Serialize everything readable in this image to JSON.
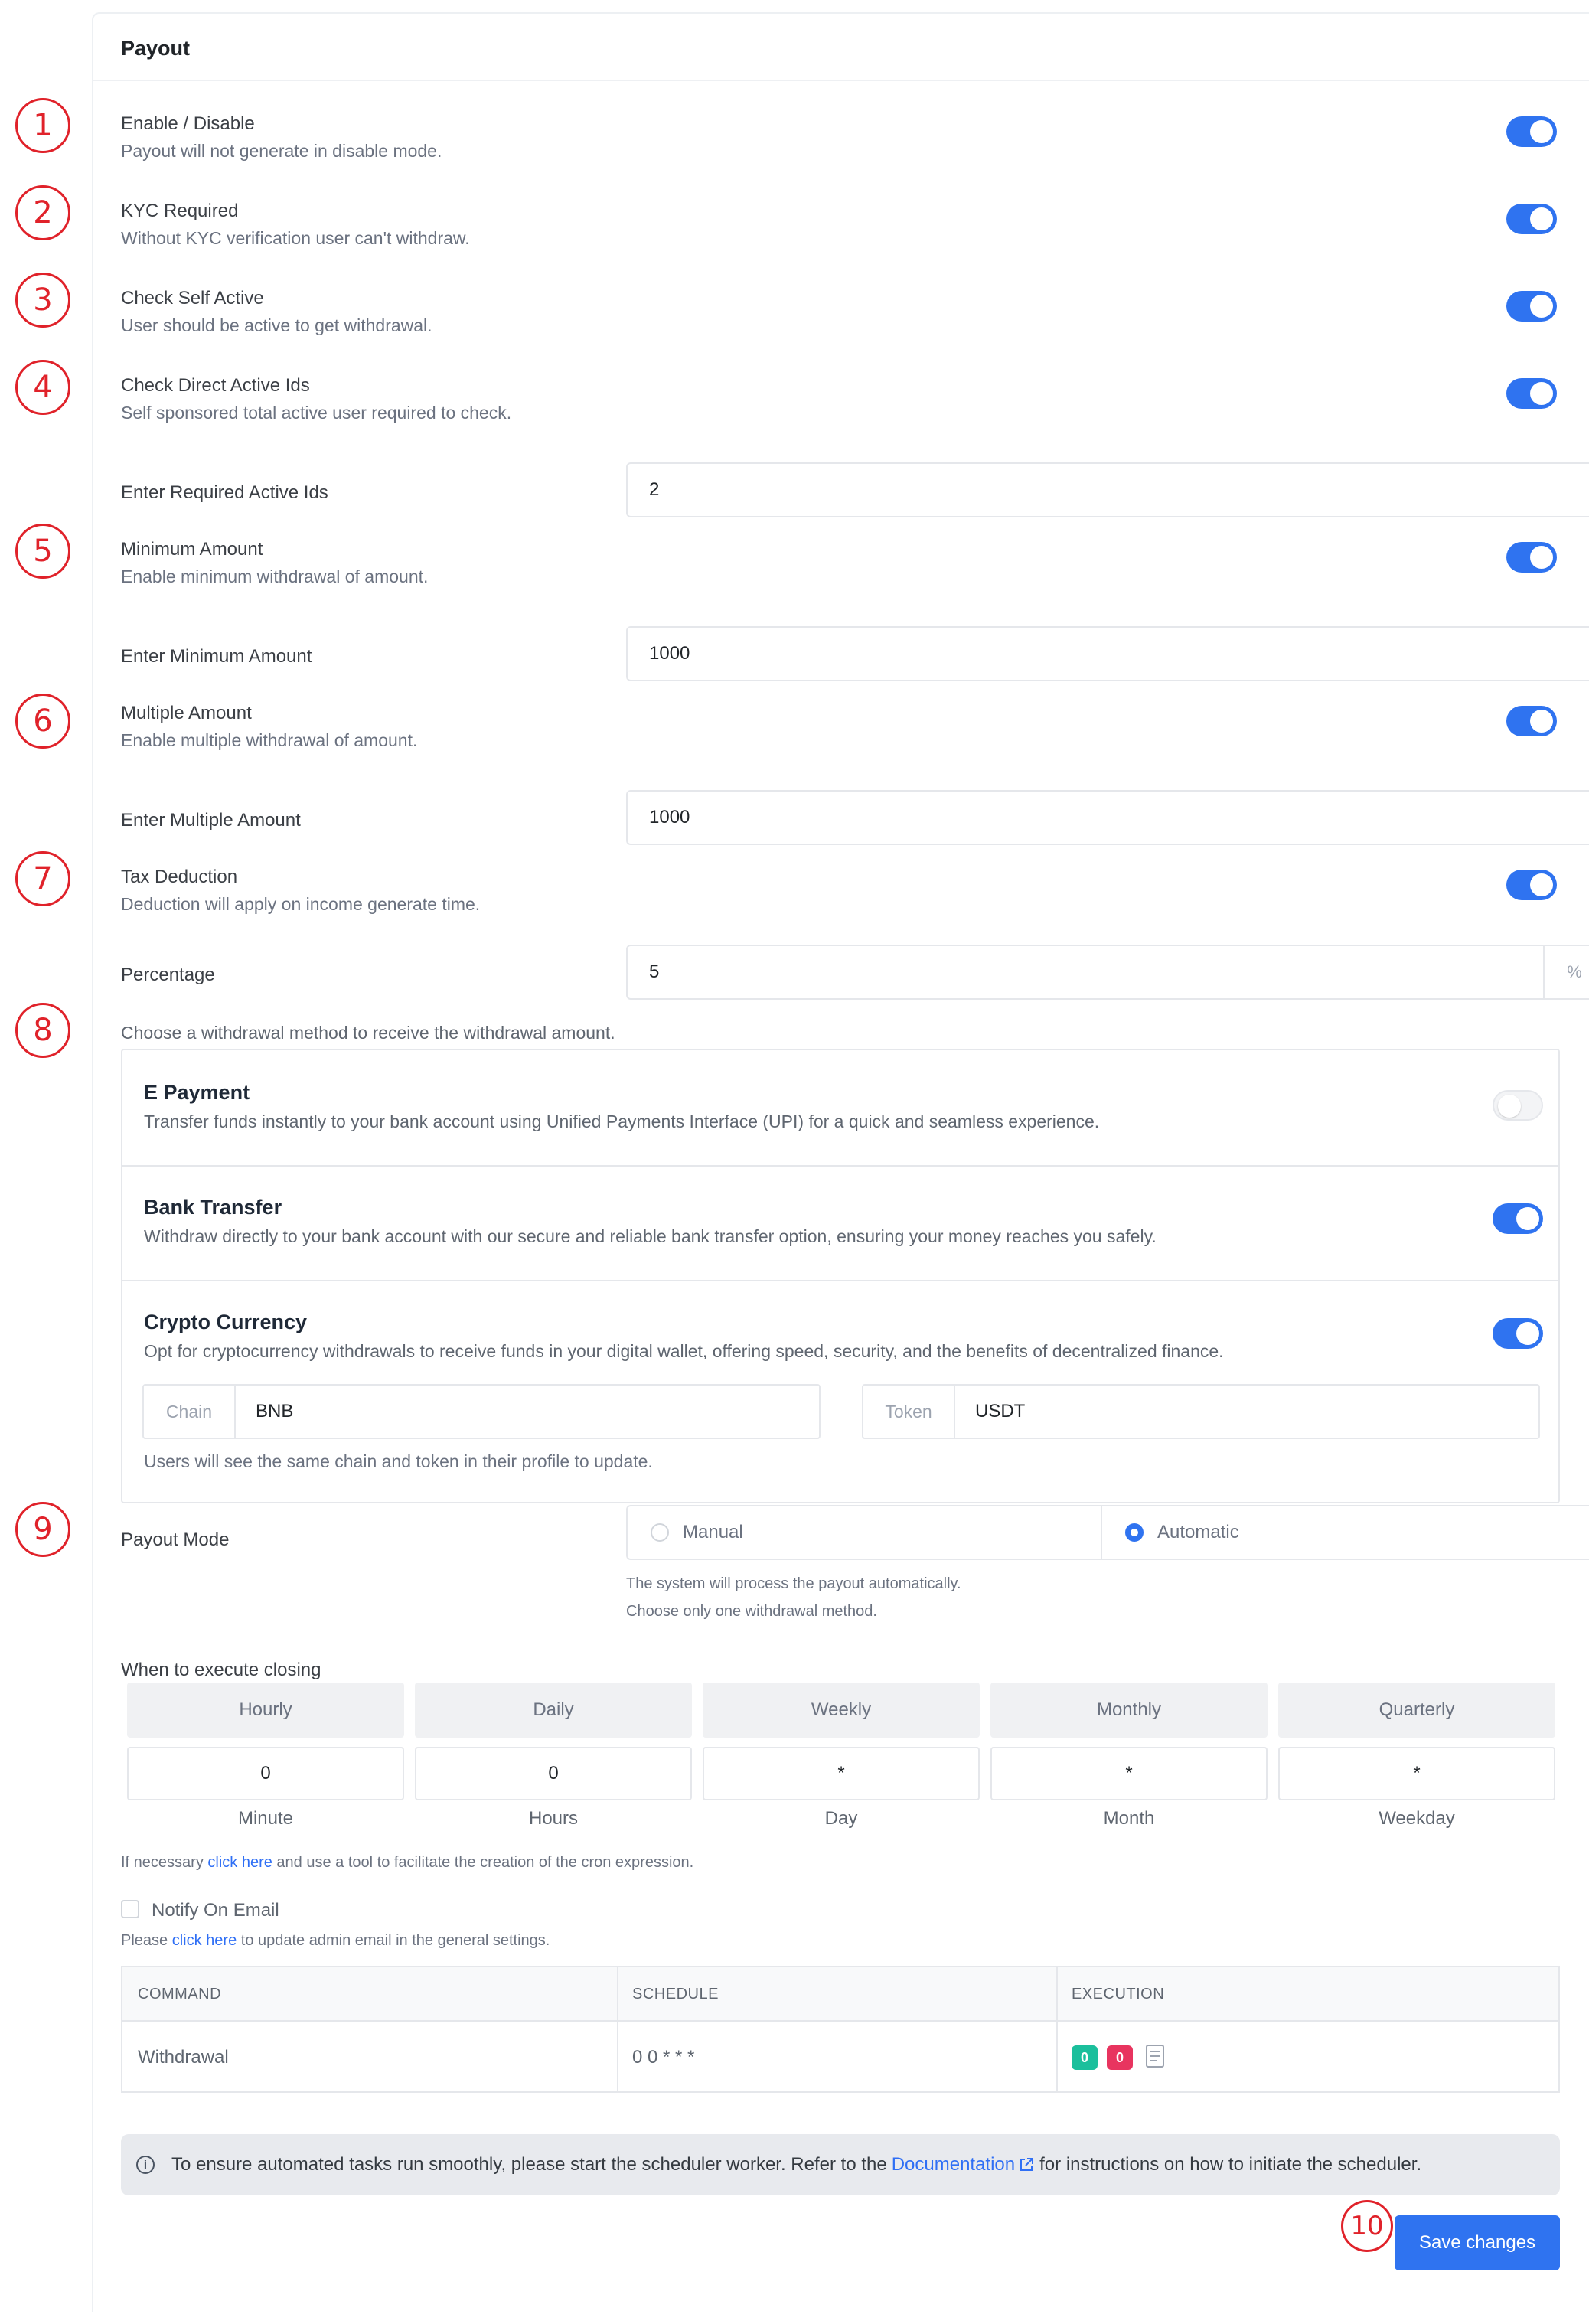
{
  "header": {
    "title": "Payout"
  },
  "settings": [
    {
      "label": "Enable / Disable",
      "desc": "Payout will not generate in disable mode.",
      "enabled": true,
      "marker": "1"
    },
    {
      "label": "KYC Required",
      "desc": "Without KYC verification user can't withdraw.",
      "enabled": true,
      "marker": "2"
    },
    {
      "label": "Check Self Active",
      "desc": "User should be active to get withdrawal.",
      "enabled": true,
      "marker": "3"
    },
    {
      "label": "Check Direct Active Ids",
      "desc": "Self sponsored total active user required to check.",
      "enabled": true,
      "marker": "4"
    },
    {
      "label": "Minimum Amount",
      "desc": "Enable minimum withdrawal of amount.",
      "enabled": true,
      "marker": "5"
    },
    {
      "label": "Multiple Amount",
      "desc": "Enable multiple withdrawal of amount.",
      "enabled": true,
      "marker": "6"
    },
    {
      "label": "Tax Deduction",
      "desc": "Deduction will apply on income generate time.",
      "enabled": true,
      "marker": "7"
    }
  ],
  "fields": {
    "required_active_ids": {
      "label": "Enter Required Active Ids",
      "value": "2"
    },
    "minimum_amount": {
      "label": "Enter Minimum Amount",
      "value": "1000"
    },
    "multiple_amount": {
      "label": "Enter Multiple Amount",
      "value": "1000"
    },
    "percentage": {
      "label": "Percentage",
      "value": "5",
      "suffix": "%"
    }
  },
  "methods_intro": "Choose a withdrawal method to receive the withdrawal amount.",
  "markers": {
    "methods": "8",
    "payout_mode": "9",
    "save": "10"
  },
  "methods": [
    {
      "title": "E Payment",
      "desc": "Transfer funds instantly to your bank account using Unified Payments Interface (UPI) for a quick and seamless experience.",
      "enabled": false
    },
    {
      "title": "Bank Transfer",
      "desc": "Withdraw directly to your bank account with our secure and reliable bank transfer option, ensuring your money reaches you safely.",
      "enabled": true
    },
    {
      "title": "Crypto Currency",
      "desc": "Opt for cryptocurrency withdrawals to receive funds in your digital wallet, offering speed, security, and the benefits of decentralized finance.",
      "enabled": true
    }
  ],
  "crypto": {
    "chain_label": "Chain",
    "chain_value": "BNB",
    "token_label": "Token",
    "token_value": "USDT",
    "help": "Users will see the same chain and token in their profile to update."
  },
  "payout_mode": {
    "label": "Payout Mode",
    "options": [
      "Manual",
      "Automatic"
    ],
    "selected": "Automatic",
    "help1": "The system will process the payout automatically.",
    "help2": "Choose only one withdrawal method."
  },
  "closing": {
    "label": "When to execute closing",
    "presets": [
      "Hourly",
      "Daily",
      "Weekly",
      "Monthly",
      "Quarterly"
    ],
    "values": [
      "0",
      "0",
      "*",
      "*",
      "*"
    ],
    "units": [
      "Minute",
      "Hours",
      "Day",
      "Month",
      "Weekday"
    ],
    "help_prefix": "If necessary ",
    "help_link": "click here",
    "help_suffix": " and use a tool to facilitate the creation of the cron expression."
  },
  "notify": {
    "label": "Notify On Email",
    "checked": false,
    "help_prefix": "Please ",
    "help_link": "click here",
    "help_suffix": " to update admin email in the general settings."
  },
  "table": {
    "headers": [
      "COMMAND",
      "SCHEDULE",
      "EXECUTION"
    ],
    "row": {
      "command": "Withdrawal",
      "schedule": "0 0 * * *",
      "success": "0",
      "failed": "0"
    },
    "colors": {
      "success": "#1bbf9c",
      "failed": "#e8345f"
    }
  },
  "alert": {
    "prefix": "To ensure automated tasks run smoothly, please start the scheduler worker. Refer to the ",
    "link": "Documentation",
    "suffix": " for instructions on how to initiate the scheduler."
  },
  "save_label": "Save changes",
  "colors": {
    "accent": "#2f73f0",
    "marker": "#e0222a"
  }
}
